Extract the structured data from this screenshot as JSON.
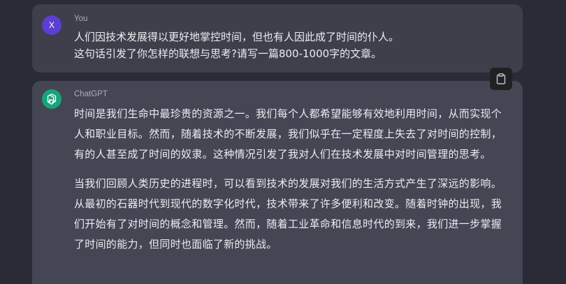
{
  "conversation": {
    "user": {
      "avatar_letter": "X",
      "sender": "You",
      "lines": [
        "人们因技术发展得以更好地掌控时间，但也有人因此成了时间的仆人。",
        "这句话引发了你怎样的联想与思考?请写一篇800-1000字的文章。"
      ]
    },
    "assistant": {
      "sender": "ChatGPT",
      "paragraphs": [
        "时间是我们生命中最珍贵的资源之一。我们每个人都希望能够有效地利用时间，从而实现个人和职业目标。然而，随着技术的不断发展，我们似乎在一定程度上失去了对时间的控制，有的人甚至成了时间的奴隶。这种情况引发了我对人们在技术发展中对时间管理的思考。",
        "当我们回顾人类历史的进程时，可以看到技术的发展对我们的生活方式产生了深远的影响。从最初的石器时代到现代的数字化时代，技术带来了许多便利和改变。随着时钟的出现，我们开始有了对时间的概念和管理。然而，随着工业革命和信息时代的到来，我们进一步掌握了时间的能力，但同时也面临了新的挑战。"
      ]
    },
    "icons": {
      "copy": "clipboard-icon",
      "assistant_logo": "openai-logo-icon"
    },
    "colors": {
      "background": "#2a2b36",
      "user_bubble": "#3e3f4b",
      "assistant_bubble": "#444654",
      "user_avatar": "#5b3fd1",
      "assistant_avatar": "#19a37c",
      "text": "#ececf1",
      "sender_text": "#acacbe"
    }
  }
}
